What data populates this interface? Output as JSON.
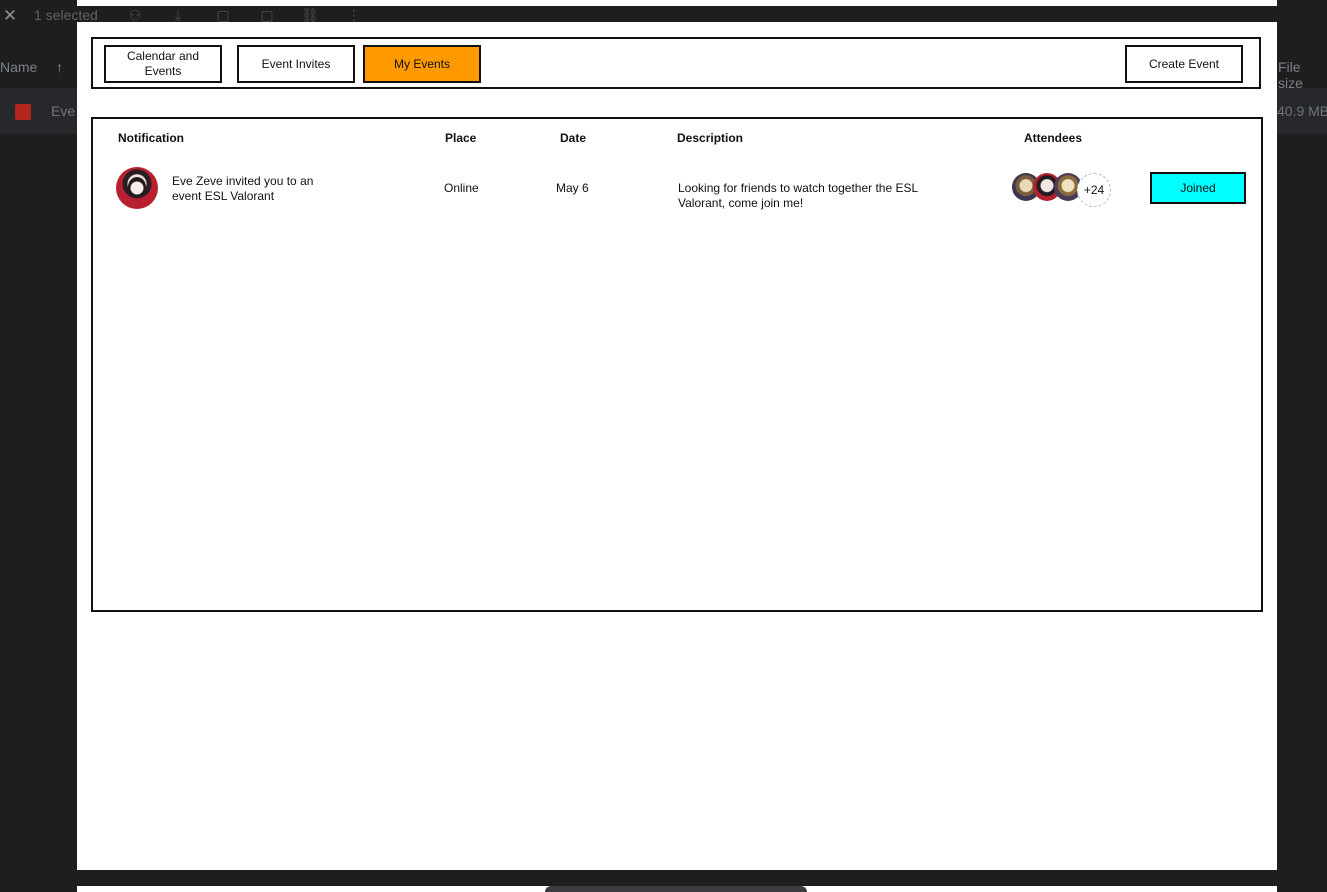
{
  "background": {
    "selection_text": "1 selected",
    "columns": {
      "name": "Name",
      "file_size": "File size"
    },
    "row": {
      "name": "Eve",
      "size": "40.9 MB"
    }
  },
  "nav": {
    "tabs": [
      {
        "label": "Calendar and Events",
        "active": false
      },
      {
        "label": "Event Invites",
        "active": false
      },
      {
        "label": "My Events",
        "active": true
      }
    ],
    "create_label": "Create Event",
    "active_color": "#ff9900"
  },
  "table": {
    "headers": {
      "notification": "Notification",
      "place": "Place",
      "date": "Date",
      "description": "Description",
      "attendees": "Attendees"
    },
    "rows": [
      {
        "notification": "Eve Zeve invited you to an event ESL Valorant",
        "place": "Online",
        "date": "May 6",
        "description": "Looking for friends to watch together the ESL Valorant, come join me!",
        "attendees_more": "+24",
        "action_label": "Joined",
        "action_color": "#00ffff"
      }
    ]
  }
}
